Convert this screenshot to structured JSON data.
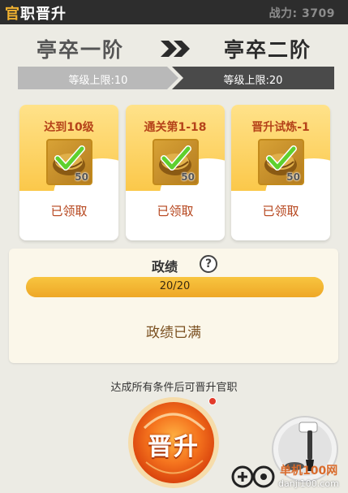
{
  "header": {
    "title_prefix": "官",
    "title_rest": "职晋升",
    "power_label": "战力: 3709"
  },
  "rank": {
    "current": "亭卒一阶",
    "next": "亭卒二阶",
    "current_level_limit": "等级上限:10",
    "next_level_limit": "等级上限:20"
  },
  "rewards": [
    {
      "title": "达到10级",
      "item_icon": "gold-ingot-icon",
      "count": "50",
      "status": "已领取"
    },
    {
      "title": "通关第1-18",
      "item_icon": "gold-ingot-icon",
      "count": "50",
      "status": "已领取"
    },
    {
      "title": "晋升试炼-1",
      "item_icon": "gold-ingot-icon",
      "count": "50",
      "status": "已领取"
    }
  ],
  "politics": {
    "title": "政绩",
    "help": "?",
    "progress_text": "20/20",
    "progress_fraction": 1.0,
    "status": "政绩已满"
  },
  "footer": {
    "hint": "达成所有条件后可晋升官职",
    "promote_label": "晋升"
  },
  "watermark": {
    "text1": "单机100网",
    "text2": "danji100.com"
  },
  "colors": {
    "header_bg": "#2d2d2d",
    "accent_gold": "#f2b230",
    "card_title": "#b5431a",
    "progress": "#f0b73a",
    "promote_orange": "#f26a1b"
  }
}
